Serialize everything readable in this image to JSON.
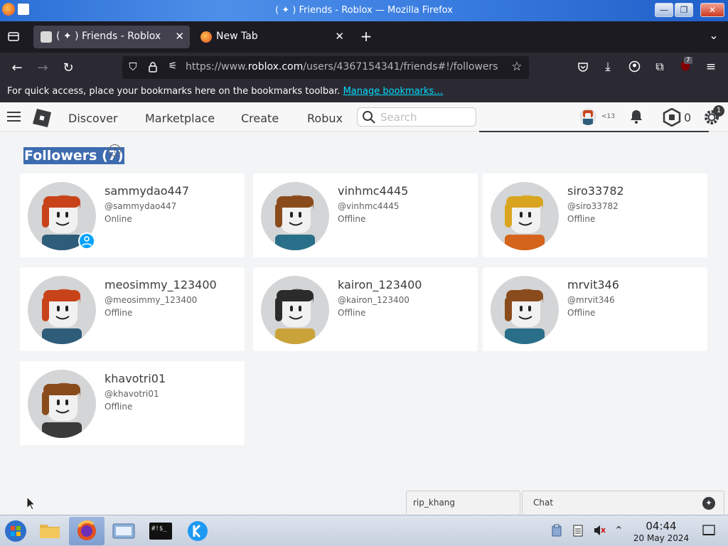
{
  "window": {
    "title": "( ✦ ) Friends - Roblox — Mozilla Firefox"
  },
  "tabs": [
    {
      "label": "( ✦ ) Friends - Roblox",
      "active": true
    },
    {
      "label": "New Tab",
      "active": false
    }
  ],
  "urlbar": {
    "url_prefix": "https://www.",
    "url_domain": "roblox.com",
    "url_path": "/users/4367154341/friends#!/followers"
  },
  "bookmarks_bar": {
    "text": "For quick access, place your bookmarks here on the bookmarks toolbar.",
    "link": "Manage bookmarks…"
  },
  "extension_badge": "7",
  "roblox_nav": {
    "items": [
      "Discover",
      "Marketplace",
      "Create",
      "Robux"
    ],
    "search_placeholder": "Search",
    "avatar_age": "<13",
    "robux_count": "0",
    "settings_badge": "1"
  },
  "page": {
    "heading": "Followers (7)",
    "help": "?"
  },
  "followers": [
    {
      "display_name": "sammydao447",
      "username": "@sammydao447",
      "status": "Online",
      "hair": "#c8431a",
      "shirt": "#2e5d7a"
    },
    {
      "display_name": "vinhmc4445",
      "username": "@vinhmc4445",
      "status": "Offline",
      "hair": "#8a4b1c",
      "shirt": "#2a6f8a"
    },
    {
      "display_name": "siro33782",
      "username": "@siro33782",
      "status": "Offline",
      "hair": "#d9a520",
      "shirt": "#d4641c"
    },
    {
      "display_name": "meosimmy_123400",
      "username": "@meosimmy_123400",
      "status": "Offline",
      "hair": "#c8431a",
      "shirt": "#2e5d7a"
    },
    {
      "display_name": "kairon_123400",
      "username": "@kairon_123400",
      "status": "Offline",
      "hair": "#2b2b2b",
      "shirt": "#c9a23a"
    },
    {
      "display_name": "mrvit346",
      "username": "@mrvit346",
      "status": "Offline",
      "hair": "#8a4b1c",
      "shirt": "#2a6f8a"
    },
    {
      "display_name": "khavotri01",
      "username": "@khavotri01",
      "status": "Offline",
      "hair": "#8a4b1c",
      "shirt": "#3a3a3a"
    }
  ],
  "chat": {
    "user": "rip_khang",
    "label": "Chat"
  },
  "taskbar": {
    "time": "04:44",
    "date": "20 May 2024",
    "terminal_text": "#!$_"
  },
  "colors": {
    "roblox_blue": "#00a2ff",
    "link_cyan": "#00ddff",
    "firefox_dark": "#1c1b22"
  }
}
